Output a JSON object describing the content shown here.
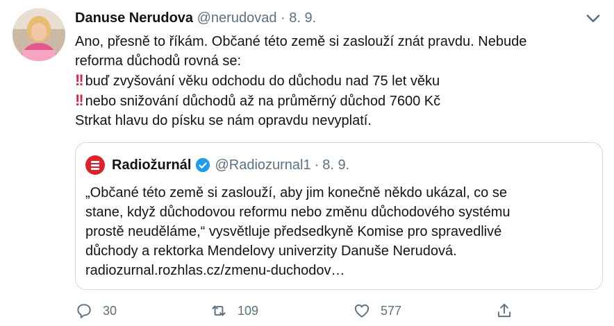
{
  "author": {
    "name": "Danuse Nerudova",
    "handle": "@nerudovad",
    "date": "8. 9."
  },
  "separator": "·",
  "tweet_lines": [
    "Ano, přesně to říkám. Občané této země si zaslouží znát pravdu. Nebude",
    "reforma důchodů rovná se:",
    "buď zvyšování věku odchodu do důchodu nad 75 let věku",
    "nebo snižování důchodů až na průměrný důchod 7600 Kč",
    "Strkat hlavu do písku se nám opravdu nevyplatí."
  ],
  "quoted": {
    "name": "Radiožurnál",
    "handle": "@Radiozurnal1",
    "date": "8. 9.",
    "lines": [
      "„Občané této země si zaslouží, aby jim konečně někdo ukázal, co se",
      "stane, když důchodovou reformu nebo změnu důchodového systému",
      "prostě neuděláme,“ vysvětluje předsedkyně Komise pro spravedlivé",
      "důchody a rektorka Mendelovy univerzity Danuše Nerudová.",
      "radiozurnal.rozhlas.cz/zmenu-duchodov…"
    ]
  },
  "actions": {
    "replies": "30",
    "retweets": "109",
    "likes": "577"
  },
  "colors": {
    "accent": "#1d9bf0",
    "muted": "#5b7083",
    "emoji_red": "#d7263d",
    "brand_red": "#e2202a"
  },
  "icons": [
    "caret-down-icon",
    "double-exclamation-icon",
    "radiozurnal-logo-icon",
    "verified-badge-icon",
    "reply-icon",
    "retweet-icon",
    "like-icon",
    "share-icon"
  ]
}
